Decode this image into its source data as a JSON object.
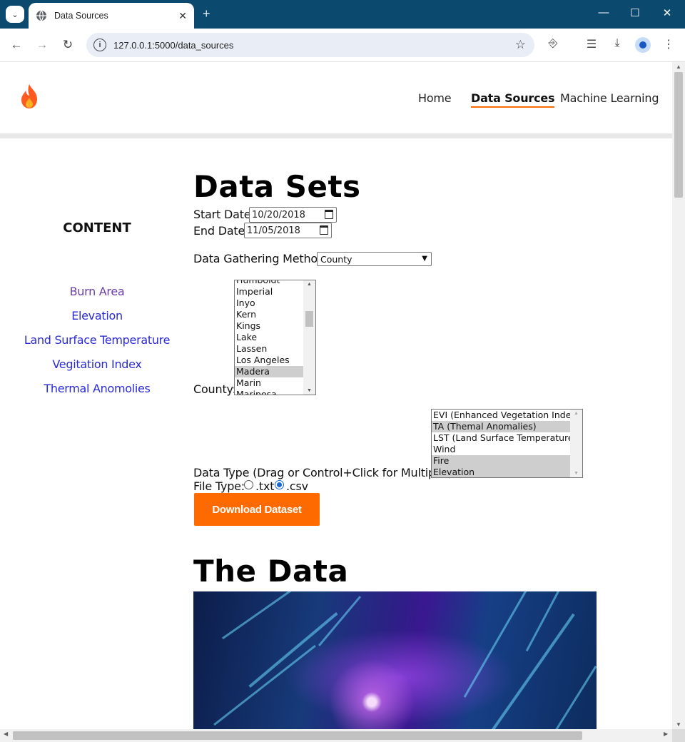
{
  "browser": {
    "tab_title": "Data Sources",
    "url": "127.0.0.1:5000/data_sources"
  },
  "nav": {
    "links": [
      "Home",
      "Data Sources",
      "Machine Learning"
    ],
    "active": "Data Sources"
  },
  "sidebar": {
    "title": "CONTENT",
    "links": [
      "Burn Area",
      "Elevation",
      "Land Surface Temperature",
      "Vegitation Index",
      "Thermal Anomolies"
    ]
  },
  "datasets": {
    "heading": "Data Sets",
    "start_date_label": "Start Date:",
    "start_date_value": "10/20/2018",
    "end_date_label": "End Date:",
    "end_date_value": "11/05/2018",
    "method_label": "Data Gathering Method:",
    "method_value": "County",
    "county_label": "County:",
    "counties": [
      "Humboldt",
      "Imperial",
      "Inyo",
      "Kern",
      "Kings",
      "Lake",
      "Lassen",
      "Los Angeles",
      "Madera",
      "Marin",
      "Mariposa"
    ],
    "county_selected": "Madera",
    "data_type_label": "Data Type (Drag or Control+Click for Multipile):",
    "data_types": [
      "EVI (Enhanced Vegetation Index)",
      "TA (Themal Anomalies)",
      "LST (Land Surface Temperature)",
      "Wind",
      "Fire",
      "Elevation"
    ],
    "data_types_selected": [
      "TA (Themal Anomalies)",
      "Fire",
      "Elevation"
    ],
    "file_type_label": "File Type:",
    "file_type_options": [
      ".txt",
      ".csv"
    ],
    "file_type_selected": ".csv",
    "download_button": "Download Dataset"
  },
  "data_section": {
    "heading": "The Data"
  },
  "colors": {
    "accent": "#ff6a00",
    "link": "#2a2ad6",
    "visited_link": "#6a3fa8",
    "chrome": "#0b4a6e"
  }
}
